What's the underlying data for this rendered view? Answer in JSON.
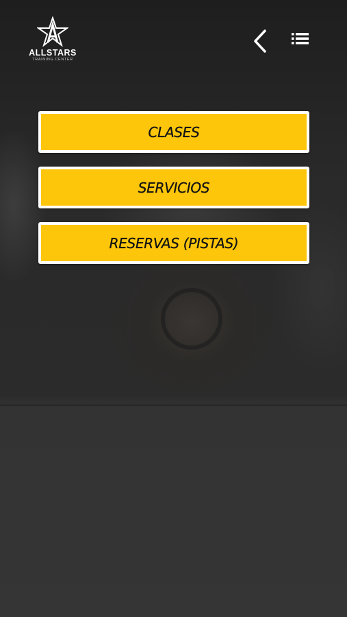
{
  "brand": {
    "name": "ALLSTARS",
    "tagline": "TRAINING CENTER",
    "logo_icon": "star-a-icon"
  },
  "header": {
    "back_icon": "chevron-left-icon",
    "menu_icon": "list-menu-icon"
  },
  "menu": {
    "items": [
      {
        "label": "CLASES"
      },
      {
        "label": "SERVICIOS"
      },
      {
        "label": "RESERVAS (PISTAS)"
      }
    ]
  },
  "colors": {
    "button_fill": "#fdc60a",
    "button_border": "#ffffff",
    "button_text": "#141414",
    "background": "#2b2b2b"
  }
}
